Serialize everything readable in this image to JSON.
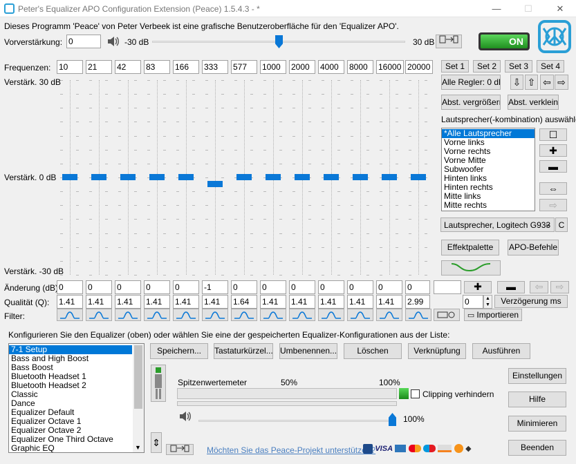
{
  "window": {
    "title": "Peter's Equalizer APO Configuration Extension (Peace) 1.5.4.3 - *",
    "minimize": "—",
    "maximize": "☐",
    "close": "✕"
  },
  "intro": "Dieses Programm 'Peace' von Peter Verbeek ist eine grafische Benutzeroberfläche für den 'Equalizer APO'.",
  "preamp": {
    "label": "Vorverstärkung:",
    "value": "0",
    "min_label": "-30 dB",
    "max_label": "30 dB",
    "level_fraction": 0.5
  },
  "power": {
    "label": "ON"
  },
  "frequencies_label": "Frequenzen:",
  "frequencies": [
    "10",
    "21",
    "42",
    "83",
    "166",
    "333",
    "577",
    "1000",
    "2000",
    "4000",
    "8000",
    "16000",
    "20000"
  ],
  "sets": [
    "Set 1",
    "Set 2",
    "Set 3",
    "Set 4"
  ],
  "gain_labels": {
    "top": "Verstärk. 30 dB",
    "mid": "Verstärk. 0 dB",
    "bottom": "Verstärk. -30 dB"
  },
  "sliders": [
    0,
    0,
    0,
    0,
    0,
    -1,
    0,
    0,
    0,
    0,
    0,
    0,
    0
  ],
  "right_panel": {
    "all_zero": "Alle Regler: 0 dB",
    "arrows": [
      "⇩",
      "⇧",
      "⇦",
      "⇨"
    ],
    "enlarge": "Abst. vergrößern",
    "shrink": "Abst. verkleinern",
    "speaker_select_label": "Lautsprecher(-kombination) auswählen:",
    "speakers": [
      "*Alle Lautsprecher",
      "Vorne links",
      "Vorne rechts",
      "Vorne Mitte",
      "Subwoofer",
      "Hinten links",
      "Hinten rechts",
      "Mitte links",
      "Mitte rechts"
    ],
    "device": "Lautsprecher, Logitech G933",
    "device_c": "C",
    "effects": "Effektpalette",
    "apo": "APO-Befehle"
  },
  "change_label": "Änderung (dB):",
  "changes": [
    "0",
    "0",
    "0",
    "0",
    "0",
    "-1",
    "0",
    "0",
    "0",
    "0",
    "0",
    "0",
    "0"
  ],
  "quality_label": "Qualität (Q):",
  "qualities": [
    "1.41",
    "1.41",
    "1.41",
    "1.41",
    "1.41",
    "1.41",
    "1.64",
    "1.41",
    "1.41",
    "1.41",
    "1.41",
    "1.41",
    "2.99"
  ],
  "filter_label": "Filter:",
  "delay": {
    "value": "0",
    "unit_button": "Verzögerung ms"
  },
  "import_button": "Importieren",
  "configure_text": "Konfigurieren Sie den Equalizer (oben) oder wählen Sie eine der gespeicherten Equalizer-Konfigurationen aus der Liste:",
  "presets": [
    "7-1 Setup",
    "Bass and High Boost",
    "Bass Boost",
    "Bluetooth Headset 1",
    "Bluetooth Headset 2",
    "Classic",
    "Dance",
    "Equalizer Default",
    "Equalizer Octave 1",
    "Equalizer Octave 2",
    "Equalizer One Third Octave",
    "Graphic EQ"
  ],
  "actions": [
    "Speichern...",
    "Tastaturkürzel...",
    "Umbenennen...",
    "Löschen",
    "Verknüpfung",
    "Ausführen"
  ],
  "meter": {
    "label": "Spitzenwertemeter",
    "p50": "50%",
    "p100": "100%",
    "clipping": "Clipping verhindern",
    "volume_label": "100%",
    "volume_fraction": 1.0
  },
  "side_buttons": [
    "Einstellungen",
    "Hilfe",
    "Minimieren",
    "Beenden"
  ],
  "support_link": "Möchten Sie das Peace-Projekt unterstützen?",
  "payment_label": "VISA",
  "colors": {
    "accent": "#0078d7",
    "on_green": "#2ea32e",
    "logo": "#2a9fd6"
  }
}
